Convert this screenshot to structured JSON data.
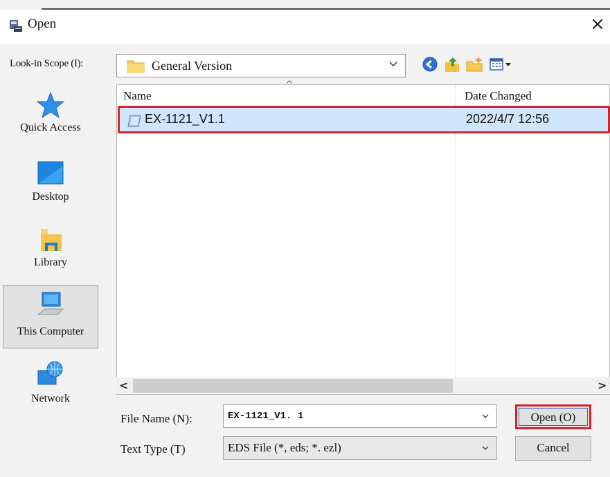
{
  "dialog": {
    "title": "Open",
    "close_glyph": "×"
  },
  "lookin": {
    "label": "Look-in Scope (I):",
    "value": "General Version",
    "toolbar_icons": [
      "back-icon",
      "up-folder-icon",
      "new-folder-icon",
      "view-menu-icon"
    ]
  },
  "places": {
    "items": [
      {
        "label": "Quick Access",
        "icon": "star-icon"
      },
      {
        "label": "Desktop",
        "icon": "desktop-icon"
      },
      {
        "label": "Library",
        "icon": "library-icon"
      },
      {
        "label": "This Computer",
        "icon": "computer-icon",
        "selected": true
      },
      {
        "label": "Network",
        "icon": "network-icon"
      }
    ]
  },
  "filelist": {
    "columns": {
      "name": "Name",
      "date": "Date Changed",
      "sort_glyph": "^"
    },
    "rows": [
      {
        "name": "EX-1121_V1.1",
        "date": "2022/4/7 12:56",
        "selected": true
      }
    ],
    "scroll_left_glyph": "<",
    "scroll_right_glyph": ">"
  },
  "form": {
    "file_name_label": "File Name (N):",
    "file_name_value": "EX-1121_V1. 1",
    "file_type_label": "Text Type (T)",
    "file_type_value": "EDS File (*, eds; *. ezl)"
  },
  "buttons": {
    "open": "Open (O)",
    "cancel": "Cancel"
  },
  "colors": {
    "highlight_outline": "#d6222a",
    "selected_row": "#cfe5fb"
  }
}
